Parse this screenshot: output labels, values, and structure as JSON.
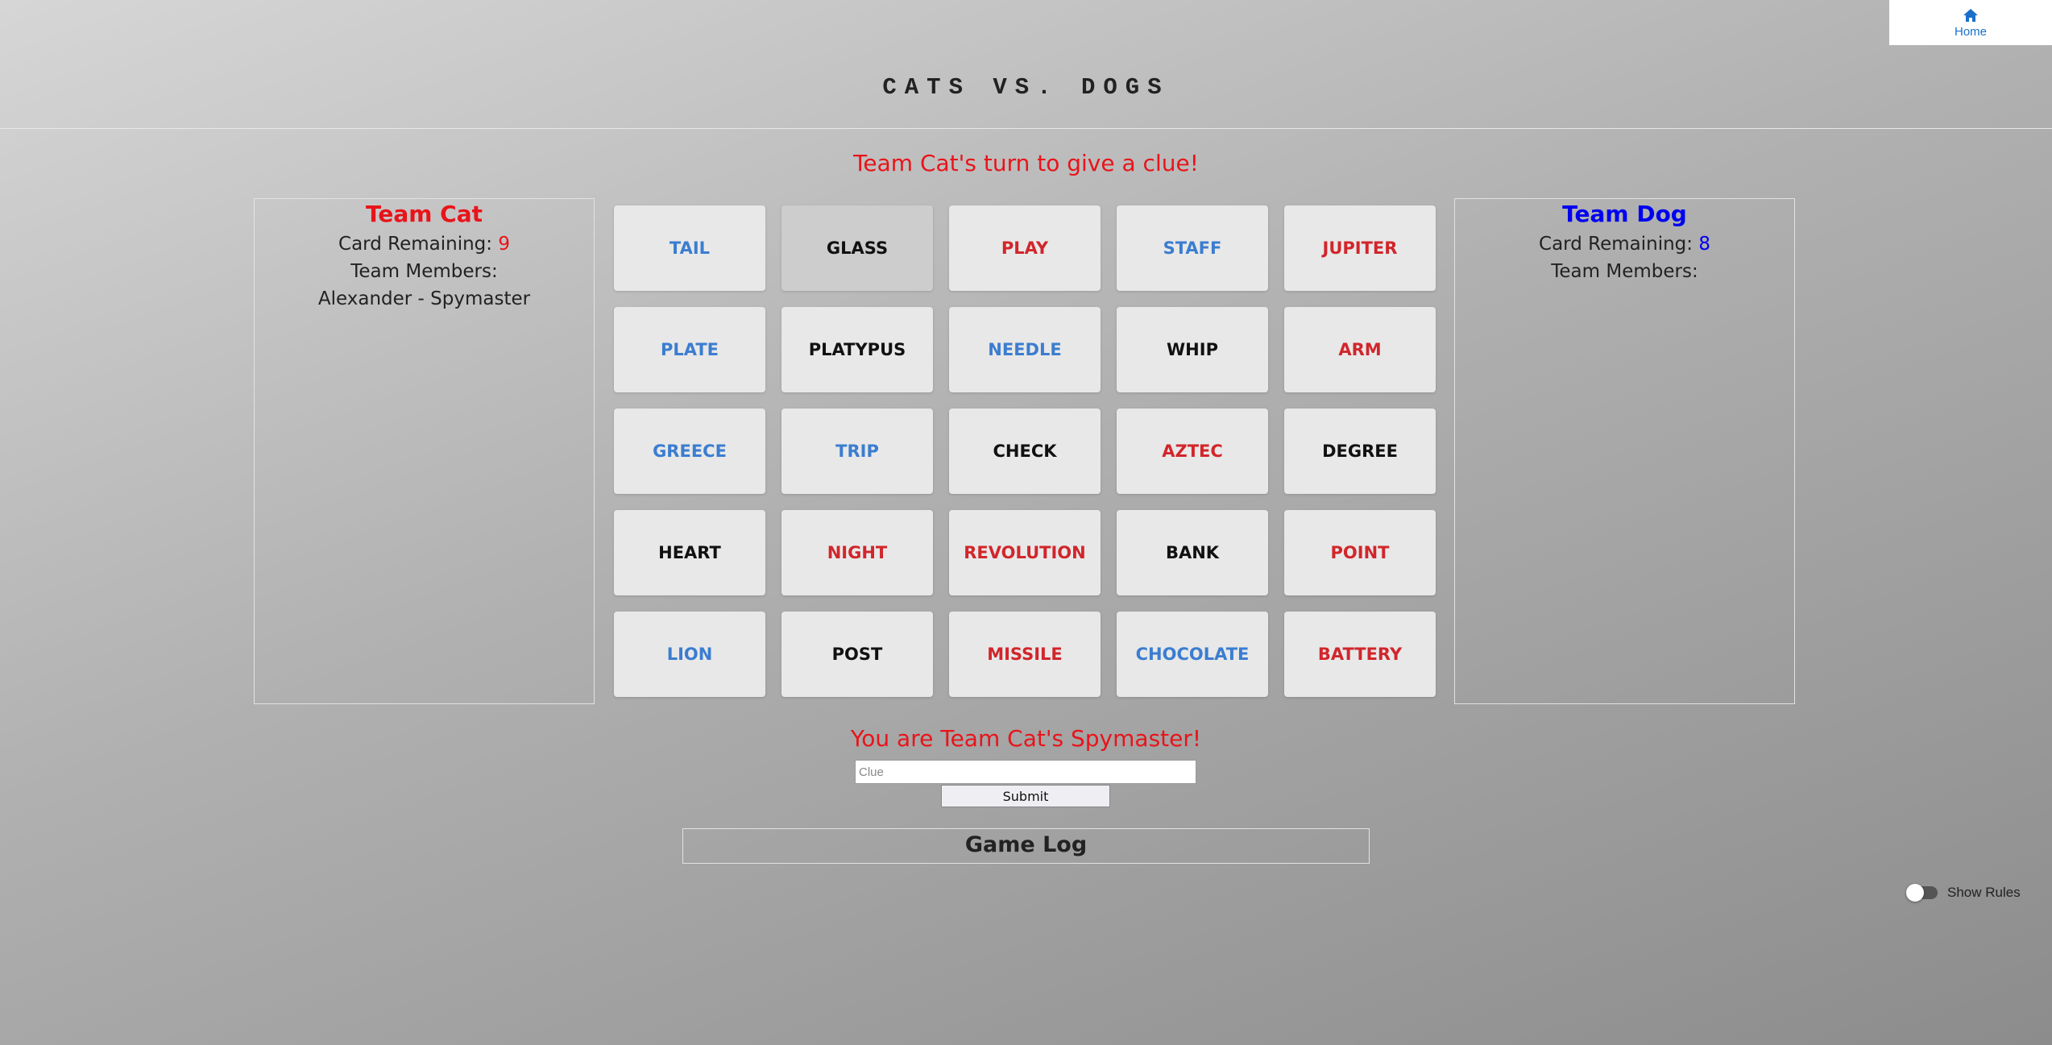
{
  "nav": {
    "home_label": "Home",
    "home_icon": "home-icon"
  },
  "title": "CATS VS. DOGS",
  "turn_message": "Team Cat's turn to give a clue!",
  "colors": {
    "red": "#e8141a",
    "blue": "#0000f0",
    "card_red": "#d1262b",
    "card_blue": "#3b7dd0",
    "card_black": "#111111"
  },
  "team_cat": {
    "name": "Team Cat",
    "remaining_label": "Card Remaining: ",
    "remaining": "9",
    "members_label": "Team Members:",
    "members": [
      "Alexander - Spymaster"
    ]
  },
  "team_dog": {
    "name": "Team Dog",
    "remaining_label": "Card Remaining: ",
    "remaining": "8",
    "members_label": "Team Members:",
    "members": []
  },
  "cards": [
    {
      "word": "TAIL",
      "color": "blue"
    },
    {
      "word": "GLASS",
      "color": "black",
      "selected": true
    },
    {
      "word": "PLAY",
      "color": "red"
    },
    {
      "word": "STAFF",
      "color": "blue"
    },
    {
      "word": "JUPITER",
      "color": "red"
    },
    {
      "word": "PLATE",
      "color": "blue"
    },
    {
      "word": "PLATYPUS",
      "color": "black"
    },
    {
      "word": "NEEDLE",
      "color": "blue"
    },
    {
      "word": "WHIP",
      "color": "black"
    },
    {
      "word": "ARM",
      "color": "red"
    },
    {
      "word": "GREECE",
      "color": "blue"
    },
    {
      "word": "TRIP",
      "color": "blue"
    },
    {
      "word": "CHECK",
      "color": "black"
    },
    {
      "word": "AZTEC",
      "color": "red"
    },
    {
      "word": "DEGREE",
      "color": "black"
    },
    {
      "word": "HEART",
      "color": "black"
    },
    {
      "word": "NIGHT",
      "color": "red"
    },
    {
      "word": "REVOLUTION",
      "color": "red"
    },
    {
      "word": "BANK",
      "color": "black"
    },
    {
      "word": "POINT",
      "color": "red"
    },
    {
      "word": "LION",
      "color": "blue"
    },
    {
      "word": "POST",
      "color": "black"
    },
    {
      "word": "MISSILE",
      "color": "red"
    },
    {
      "word": "CHOCOLATE",
      "color": "blue"
    },
    {
      "word": "BATTERY",
      "color": "red"
    }
  ],
  "spymaster_message": "You are Team Cat's Spymaster!",
  "clue": {
    "placeholder": "Clue",
    "value": ""
  },
  "submit_label": "Submit",
  "game_log": {
    "title": "Game Log"
  },
  "rules_toggle": {
    "label": "Show Rules",
    "on": false
  }
}
